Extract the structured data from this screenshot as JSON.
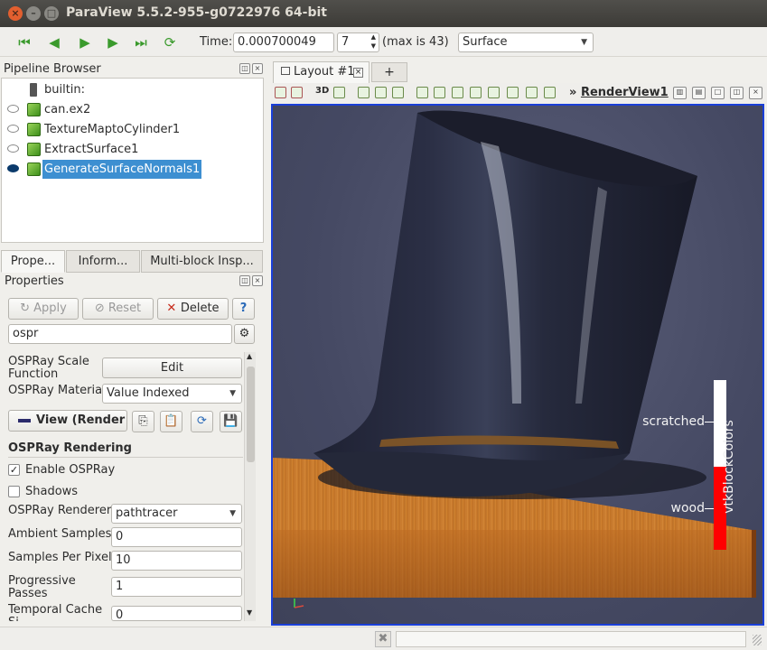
{
  "window": {
    "title": "ParaView 5.5.2-955-g0722976 64-bit"
  },
  "toolbar": {
    "time_label": "Time:",
    "time_value": "0.000700049",
    "timestep_value": "7",
    "max_label": "(max is 43)",
    "representation": "Surface"
  },
  "pipeline": {
    "title": "Pipeline Browser",
    "items": [
      {
        "label": "builtin:"
      },
      {
        "label": "can.ex2"
      },
      {
        "label": "TextureMaptoCylinder1"
      },
      {
        "label": "ExtractSurface1"
      },
      {
        "label": "GenerateSurfaceNormals1"
      }
    ]
  },
  "tabs": [
    {
      "label": "Prope..."
    },
    {
      "label": "Inform..."
    },
    {
      "label": "Multi-block Insp..."
    }
  ],
  "properties": {
    "title": "Properties",
    "apply_label": "Apply",
    "reset_label": "Reset",
    "delete_label": "Delete",
    "help_label": "?",
    "search_value": "ospr",
    "scale_function_label": "OSPRay Scale Function",
    "edit_label": "Edit",
    "material_label": "OSPRay Material",
    "material_value": "Value Indexed",
    "view_section_label": "View (Render",
    "ospray_section": "OSPRay Rendering",
    "enable_ospray_label": "Enable OSPRay",
    "shadows_label": "Shadows",
    "renderer_label": "OSPRay Renderer",
    "renderer_value": "pathtracer",
    "ambient_label": "Ambient Samples",
    "ambient_value": "0",
    "spp_label": "Samples Per Pixel",
    "spp_value": "10",
    "progressive_label": "Progressive Passes",
    "progressive_value": "1",
    "temporal_label": "Temporal Cache Si",
    "temporal_value": "0"
  },
  "layout": {
    "tab_label": "Layout #1",
    "add_tab": "+",
    "view_title": "RenderView1",
    "three_d_label": "3D"
  },
  "legend": {
    "title": "vtkBlockColors",
    "entries": [
      {
        "label": "scratched",
        "color": "#ffffff"
      },
      {
        "label": "wood",
        "color": "#ff0000"
      }
    ]
  },
  "colors": {
    "accent": "#3d8fd1",
    "view_border": "#1a3fd8",
    "background": "#454963"
  }
}
